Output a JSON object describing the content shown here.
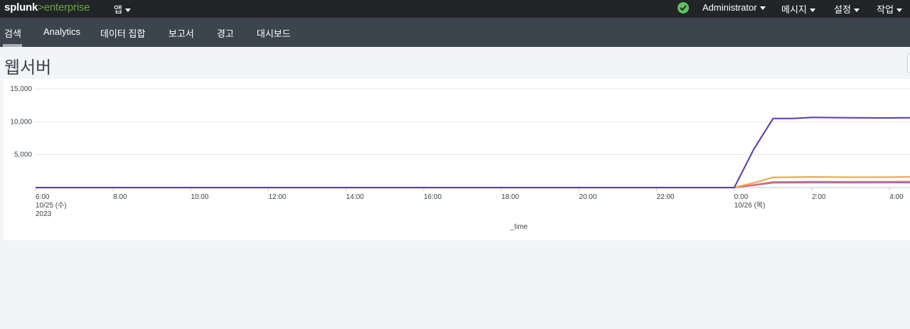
{
  "topbar": {
    "logo_a": "splunk",
    "logo_b": ">enterprise",
    "app_menu": "앱",
    "status_icon": "check-circle-icon",
    "user_menu": "Administrator",
    "messages_menu": "메시지",
    "settings_menu": "설정",
    "activity_menu": "작업"
  },
  "nav": {
    "items": [
      "검색",
      "Analytics",
      "데이터 집합",
      "보고서",
      "경고",
      "대시보드"
    ],
    "active": "검색"
  },
  "page": {
    "title": "웹서버"
  },
  "colors": {
    "topbar": "#212527",
    "navbar": "#3c444d",
    "series1": "#5a35c6",
    "series2": "#f7a338",
    "series3": "#e26a6a",
    "series4": "#8a72d6"
  },
  "chart_data": {
    "type": "line",
    "xlabel": "_time",
    "ylabel": "",
    "ylim": [
      0,
      15000
    ],
    "y_ticks": [
      {
        "value": 5000,
        "label": "5,000"
      },
      {
        "value": 10000,
        "label": "10,000"
      },
      {
        "value": 15000,
        "label": "15,000"
      }
    ],
    "x_ticks": [
      {
        "hour": 6,
        "label": "6:00",
        "date": "10/25 (수)",
        "year": "2023"
      },
      {
        "hour": 8,
        "label": "8:00"
      },
      {
        "hour": 10,
        "label": "10:00"
      },
      {
        "hour": 12,
        "label": "12:00"
      },
      {
        "hour": 14,
        "label": "14:00"
      },
      {
        "hour": 16,
        "label": "16:00"
      },
      {
        "hour": 18,
        "label": "18:00"
      },
      {
        "hour": 20,
        "label": "20:00"
      },
      {
        "hour": 22,
        "label": "22:00"
      },
      {
        "hour": 24,
        "label": "0:00",
        "date": "10/26 (목)"
      },
      {
        "hour": 26,
        "label": "2:00"
      },
      {
        "hour": 28,
        "label": "4:00"
      }
    ],
    "x_range_hours": [
      6,
      29.3
    ],
    "series": [
      {
        "color": "#5a35c6",
        "points": [
          [
            6,
            0
          ],
          [
            24,
            0
          ],
          [
            24.5,
            5800
          ],
          [
            25,
            10500
          ],
          [
            25.5,
            10500
          ],
          [
            26,
            10650
          ],
          [
            27,
            10600
          ],
          [
            28,
            10580
          ],
          [
            29.3,
            10650
          ]
        ]
      },
      {
        "color": "#f7a338",
        "points": [
          [
            6,
            0
          ],
          [
            24,
            0
          ],
          [
            24.5,
            700
          ],
          [
            25,
            1550
          ],
          [
            26,
            1620
          ],
          [
            27,
            1580
          ],
          [
            28,
            1600
          ],
          [
            29.3,
            1650
          ]
        ]
      },
      {
        "color": "#e26a6a",
        "points": [
          [
            6,
            0
          ],
          [
            24,
            0
          ],
          [
            24.5,
            400
          ],
          [
            25,
            850
          ],
          [
            26,
            900
          ],
          [
            27,
            880
          ],
          [
            28,
            900
          ],
          [
            29.3,
            920
          ]
        ]
      },
      {
        "color": "#8a72d6",
        "points": [
          [
            6,
            0
          ],
          [
            24,
            0
          ],
          [
            24.5,
            350
          ],
          [
            25,
            720
          ],
          [
            26,
            760
          ],
          [
            27,
            740
          ],
          [
            28,
            760
          ],
          [
            29.3,
            770
          ]
        ]
      }
    ]
  }
}
